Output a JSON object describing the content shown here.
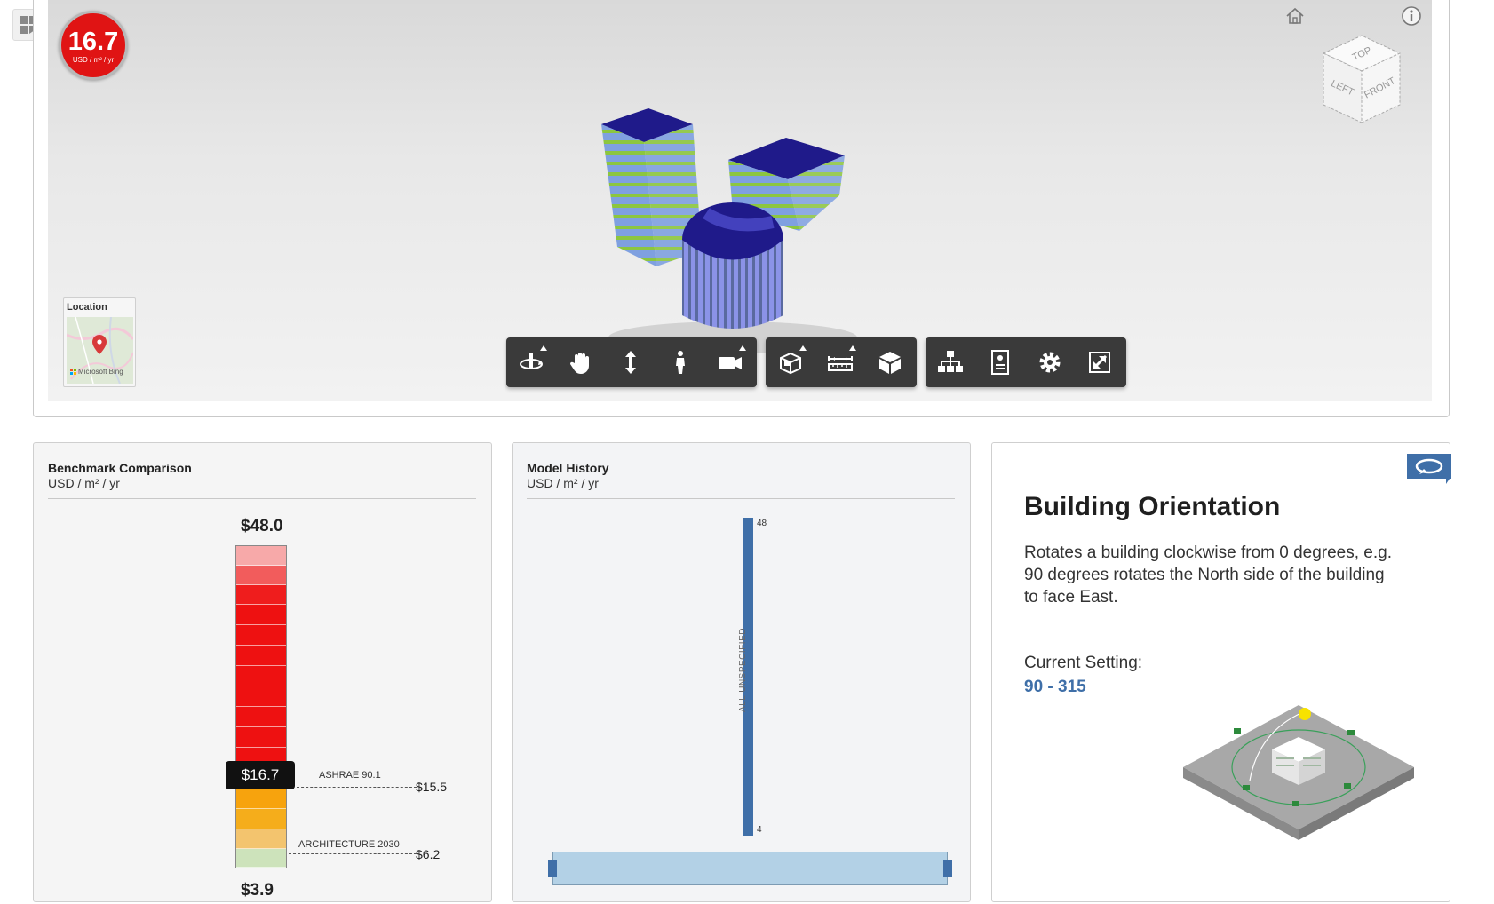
{
  "viewer": {
    "eui_value": "16.7",
    "eui_unit": "USD / m² / yr",
    "location_label": "Location",
    "map_attribution": "Microsoft Bing",
    "viewcube": {
      "top": "TOP",
      "left": "LEFT",
      "front": "FRONT"
    },
    "toolbar_icons": [
      "orbit-icon",
      "pan-icon",
      "zoom-icon",
      "walk-icon",
      "camera-icon",
      "section-icon",
      "measure-icon",
      "model-icon",
      "structure-icon",
      "properties-icon",
      "settings-icon",
      "fullscreen-icon"
    ]
  },
  "benchmark": {
    "title": "Benchmark Comparison",
    "unit": "USD / m² / yr",
    "max_label": "$48.0",
    "min_label": "$3.9",
    "current_label": "$16.7",
    "current_value": 16.7,
    "markers": [
      {
        "name": "ASHRAE 90.1",
        "value_label": "$15.5"
      },
      {
        "name": "ARCHITECTURE 2030",
        "value_label": "$6.2"
      }
    ]
  },
  "history": {
    "title": "Model History",
    "unit": "USD / m² / yr",
    "top_tick": "48",
    "bottom_tick": "4",
    "bar_label": "ALL UNSPECIFIED"
  },
  "orientation": {
    "title": "Building Orientation",
    "description": "Rotates a building clockwise from 0 degrees, e.g. 90 degrees rotates the North side of the building to face East.",
    "current_setting_label": "Current Setting:",
    "current_setting_value": "90 - 315"
  },
  "colors": {
    "eui_badge": "#e01414",
    "accent_blue": "#3f6fa8",
    "toolbar": "#3a3a3a"
  }
}
